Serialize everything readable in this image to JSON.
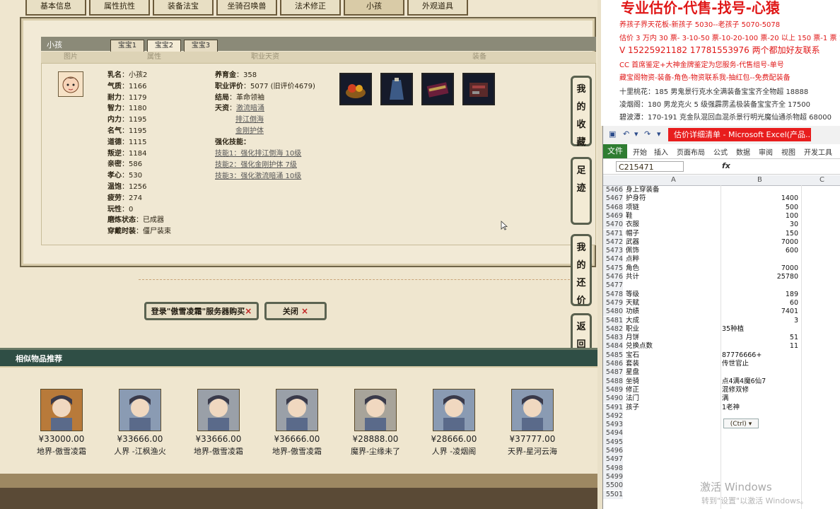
{
  "game": {
    "tabs": [
      "基本信息",
      "属性抗性",
      "装备法宝",
      "坐骑召唤兽",
      "法术修正",
      "小孩",
      "外观道具"
    ],
    "active_tab": 5,
    "panel_title": "小孩",
    "subtabs": [
      "宝宝1",
      "宝宝2",
      "宝宝3"
    ],
    "active_subtab": 1,
    "columns": [
      "图片",
      "属性",
      "职业天资",
      "装备"
    ],
    "child_stats_left": [
      {
        "k": "乳名",
        "v": "小孩2"
      },
      {
        "k": "气质",
        "v": "1166"
      },
      {
        "k": "耐力",
        "v": "1179"
      },
      {
        "k": "智力",
        "v": "1180"
      },
      {
        "k": "内力",
        "v": "1195"
      },
      {
        "k": "名气",
        "v": "1195"
      },
      {
        "k": "道德",
        "v": "1115"
      },
      {
        "k": "叛逆",
        "v": "1184"
      },
      {
        "k": "亲密",
        "v": "586"
      },
      {
        "k": "孝心",
        "v": "530"
      },
      {
        "k": "温饱",
        "v": "1256"
      },
      {
        "k": "疲劳",
        "v": "274"
      },
      {
        "k": "玩性",
        "v": "0"
      },
      {
        "k": "磨炼状态",
        "v": "已成器"
      },
      {
        "k": "穿戴时装",
        "v": "僵尸装束"
      }
    ],
    "child_stats_right": [
      {
        "k": "养育金",
        "v": "358"
      },
      {
        "k": "职业评价",
        "v": "5077 (旧评价4679)"
      },
      {
        "k": "结局",
        "v": "革命领袖"
      },
      {
        "k": "天资",
        "v": "激流暗涌"
      }
    ],
    "talents_extra": [
      "排江倒海",
      "金刚护体"
    ],
    "skills_title": "强化技能：",
    "skills": [
      "技能1：强化排江倒海 10级",
      "技能2：强化金刚护体 7级",
      "技能3：强化激流暗涌 10级"
    ],
    "side_buttons": [
      "我的收藏",
      "足迹",
      "我的还价",
      "返回顶部"
    ],
    "buttons": {
      "login": "登录\"傲雪凌霜\"服务器购买",
      "close": "关闭"
    },
    "similar_title": "相似物品推荐",
    "recommend": [
      {
        "price": "¥33000.00",
        "server": "地界-傲雪凌霜"
      },
      {
        "price": "¥33666.00",
        "server": "人界 -江枫渔火"
      },
      {
        "price": "¥33666.00",
        "server": "地界-傲雪凌霜"
      },
      {
        "price": "¥36666.00",
        "server": "地界-傲雪凌霜"
      },
      {
        "price": "¥28888.00",
        "server": "魔界-尘缘未了"
      },
      {
        "price": "¥28666.00",
        "server": "人界 -凌烟阁"
      },
      {
        "price": "¥37777.00",
        "server": "天界-星河云海"
      }
    ]
  },
  "ad": {
    "headline": "专业估价-代售-找号-心猿",
    "lines": [
      "养孩子界天花板-新孩子 5030--老孩子 5070-5078",
      "估价 3 万内 30 票- 3-10-50 票-10-20-100 票-20 以上 150 票-1 票 1 元",
      "V 15225921182    17781553976   两个都加好友联系",
      "CC 首席鉴定+大神金牌鉴定为您服务-代售组号-单号",
      "藏宝阁物资-装备-角色-物资联系我-抽红包--免费配装备",
      "十里桃花：185 男鬼景行克水全满装备宝宝齐全物超 18888",
      "凌烟阁：180 男龙克火 5 级强霹雳孟极装备宝宝齐全 17500",
      "碧波潭：170-191 克金队混回血混杀景行明光魔仙通杀物超 68000"
    ]
  },
  "excel": {
    "title": "估价详细清单 - Microsoft Excel(产品...",
    "ribbon": [
      "开始",
      "插入",
      "页面布局",
      "公式",
      "数据",
      "审阅",
      "视图",
      "开发工具"
    ],
    "file_tab": "文件",
    "namebox": "C215471",
    "fx": "fx",
    "col_headers": [
      "A",
      "B",
      "C"
    ],
    "rows": [
      {
        "n": "5466",
        "a": "身上穿装备",
        "b": ""
      },
      {
        "n": "5467",
        "a": "护身符",
        "b": "1400",
        "num": true
      },
      {
        "n": "5468",
        "a": "项链",
        "b": "500",
        "num": true
      },
      {
        "n": "5469",
        "a": "鞋",
        "b": "100",
        "num": true
      },
      {
        "n": "5470",
        "a": "衣服",
        "b": "30",
        "num": true
      },
      {
        "n": "5471",
        "a": "帽子",
        "b": "150",
        "num": true
      },
      {
        "n": "5472",
        "a": "武器",
        "b": "7000",
        "num": true
      },
      {
        "n": "5473",
        "a": "佩饰",
        "b": "600",
        "num": true
      },
      {
        "n": "5474",
        "a": "点粹",
        "b": ""
      },
      {
        "n": "5475",
        "a": "角色",
        "b": "7000",
        "num": true
      },
      {
        "n": "5476",
        "a": "共计",
        "b": "25780",
        "num": true
      },
      {
        "n": "5477",
        "a": "",
        "b": ""
      },
      {
        "n": "5478",
        "a": "等级",
        "b": "189",
        "num": true
      },
      {
        "n": "5479",
        "a": "天赋",
        "b": "60",
        "num": true
      },
      {
        "n": "5480",
        "a": "功绩",
        "b": "7401",
        "num": true
      },
      {
        "n": "5481",
        "a": "大成",
        "b": "3",
        "num": true
      },
      {
        "n": "5482",
        "a": "职业",
        "b": "35种植"
      },
      {
        "n": "5483",
        "a": "月饼",
        "b": "51",
        "num": true
      },
      {
        "n": "5484",
        "a": "兑换点数",
        "b": "11",
        "num": true
      },
      {
        "n": "5485",
        "a": "宝石",
        "b": "87776666+"
      },
      {
        "n": "5486",
        "a": "套装",
        "b": "传世官止"
      },
      {
        "n": "5487",
        "a": "星盘",
        "b": ""
      },
      {
        "n": "5488",
        "a": "坐骑",
        "b": "点4满4魔6仙7"
      },
      {
        "n": "5489",
        "a": "修正",
        "b": "混修双修"
      },
      {
        "n": "5490",
        "a": "法门",
        "b": "满"
      },
      {
        "n": "5491",
        "a": "孩子",
        "b": "1老神"
      },
      {
        "n": "5492",
        "a": "",
        "b": ""
      },
      {
        "n": "5493",
        "a": "",
        "b": ""
      },
      {
        "n": "5494",
        "a": "",
        "b": ""
      },
      {
        "n": "5495",
        "a": "",
        "b": ""
      },
      {
        "n": "5496",
        "a": "",
        "b": ""
      },
      {
        "n": "5497",
        "a": "",
        "b": ""
      },
      {
        "n": "5498",
        "a": "",
        "b": ""
      },
      {
        "n": "5499",
        "a": "",
        "b": ""
      },
      {
        "n": "5500",
        "a": "",
        "b": ""
      },
      {
        "n": "5501",
        "a": "",
        "b": ""
      }
    ],
    "paste_options": "(Ctrl)"
  },
  "watermark": {
    "line1": "激活 Windows",
    "line2": "转到\"设置\"以激活 Windows。"
  }
}
